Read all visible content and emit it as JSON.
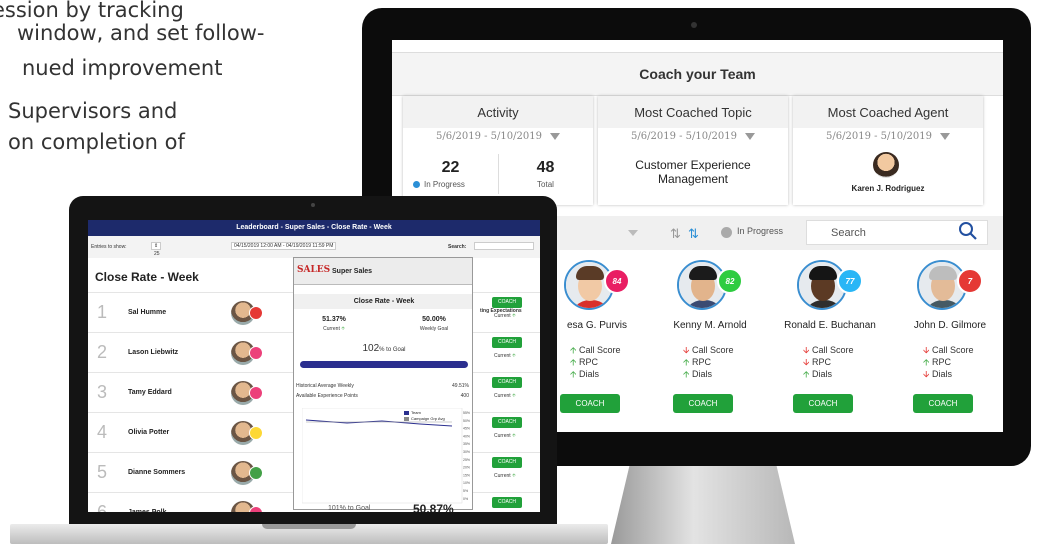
{
  "intro_lines": [
    "ession by tracking",
    " window, and set follow-",
    "nued improvement",
    "Supervisors and",
    "on completion of"
  ],
  "coach": {
    "title": "Coach your Team",
    "cards": [
      {
        "title": "Activity",
        "date": "5/6/2019 - 5/10/2019",
        "in_progress_value": "22",
        "in_progress_label": "In Progress",
        "total_value": "48",
        "total_label": "Total"
      },
      {
        "title": "Most Coached Topic",
        "date": "5/6/2019 - 5/10/2019",
        "topic_line1": "Customer Experience",
        "topic_line2": "Management"
      },
      {
        "title": "Most Coached Agent",
        "date": "5/6/2019 - 5/10/2019",
        "agent": "Karen J. Rodriguez"
      }
    ],
    "toolbar": {
      "filter_label": "In Progress",
      "search_placeholder": "Search"
    },
    "agents": [
      {
        "name": "esa G. Purvis",
        "badge": "84",
        "badge_color": "#e91e63",
        "skin": "#f1c9a5",
        "hair": "#5a3b26",
        "body": "#d9302b",
        "metrics": [
          {
            "arrow": "up",
            "label": "Call Score"
          },
          {
            "arrow": "up",
            "label": "RPC"
          },
          {
            "arrow": "up",
            "label": "Dials"
          }
        ],
        "button": "COACH"
      },
      {
        "name": "Kenny M. Arnold",
        "badge": "82",
        "badge_color": "#2ecc40",
        "skin": "#e2b48c",
        "hair": "#1b1b1b",
        "body": "#3b4b73",
        "metrics": [
          {
            "arrow": "down",
            "label": "Call Score"
          },
          {
            "arrow": "up",
            "label": "RPC"
          },
          {
            "arrow": "up",
            "label": "Dials"
          }
        ],
        "button": "COACH"
      },
      {
        "name": "Ronald E. Buchanan",
        "badge": "77",
        "badge_color": "#29b6f6",
        "skin": "#5c3a24",
        "hair": "#151515",
        "body": "#2e2e2e",
        "metrics": [
          {
            "arrow": "down",
            "label": "Call Score"
          },
          {
            "arrow": "down",
            "label": "RPC"
          },
          {
            "arrow": "up",
            "label": "Dials"
          }
        ],
        "button": "COACH"
      },
      {
        "name": "John D. Gilmore",
        "badge": "7",
        "badge_color": "#e53935",
        "skin": "#e3bb98",
        "hair": "#bdbdbd",
        "body": "#455a64",
        "metrics": [
          {
            "arrow": "down",
            "label": "Call Score"
          },
          {
            "arrow": "up",
            "label": "RPC"
          },
          {
            "arrow": "down",
            "label": "Dials"
          }
        ],
        "button": "COACH"
      }
    ]
  },
  "leaderboard": {
    "header": "Leaderboard - Super Sales - Close Rate - Week",
    "entries_label": "Entries to show:",
    "entries_value": "25",
    "date_range": "04/15/2019 12:00 AM - 04/19/2019 11:59 PM",
    "search_label": "Search:",
    "title": "Close Rate - Week",
    "expectations_header": "ting Expectations",
    "rows": [
      {
        "rank": "1",
        "name": "Sal Humme",
        "badge_color": "#e53935",
        "button": "COACH",
        "status": "Current"
      },
      {
        "rank": "2",
        "name": "Lason Liebwitz",
        "badge_color": "#ec407a",
        "button": "COACH",
        "status": "Current"
      },
      {
        "rank": "3",
        "name": "Tamy Eddard",
        "badge_color": "#ec407a",
        "button": "COACH",
        "status": "Current"
      },
      {
        "rank": "4",
        "name": "Olivia Potter",
        "badge_color": "#fdd835",
        "button": "COACH",
        "status": "Current"
      },
      {
        "rank": "5",
        "name": "Dianne Sommers",
        "badge_color": "#43a047",
        "button": "COACH",
        "status": "Current"
      },
      {
        "rank": "6",
        "name": "James Polk",
        "badge_color": "#ec407a",
        "button": "COACH",
        "status": ""
      }
    ],
    "popup": {
      "logo": "SALES",
      "title": "Super Sales",
      "subtitle": "Close Rate - Week",
      "current_value": "51.37%",
      "current_label": "Current",
      "goal_value": "50.00%",
      "goal_label": "Weekly Goal",
      "to_goal_pct": "102",
      "to_goal_suffix": "% to Goal",
      "progress_fraction": 1.0,
      "hist_label": "Historical Average Weekly",
      "hist_value": "49.51%",
      "xp_label": "Available Experience Points",
      "xp_value": "400",
      "legend": [
        {
          "name": "Team",
          "color": "#2b2f8f"
        },
        {
          "name": "Campaign Grp Avg",
          "color": "#888888"
        }
      ],
      "axis_ticks": [
        "55%",
        "50%",
        "45%",
        "40%",
        "35%",
        "30%",
        "25%",
        "20%",
        "15%",
        "10%",
        "5%",
        "0%"
      ]
    },
    "footer_goal": "101% to Goal",
    "footer_value": "50.87%"
  }
}
